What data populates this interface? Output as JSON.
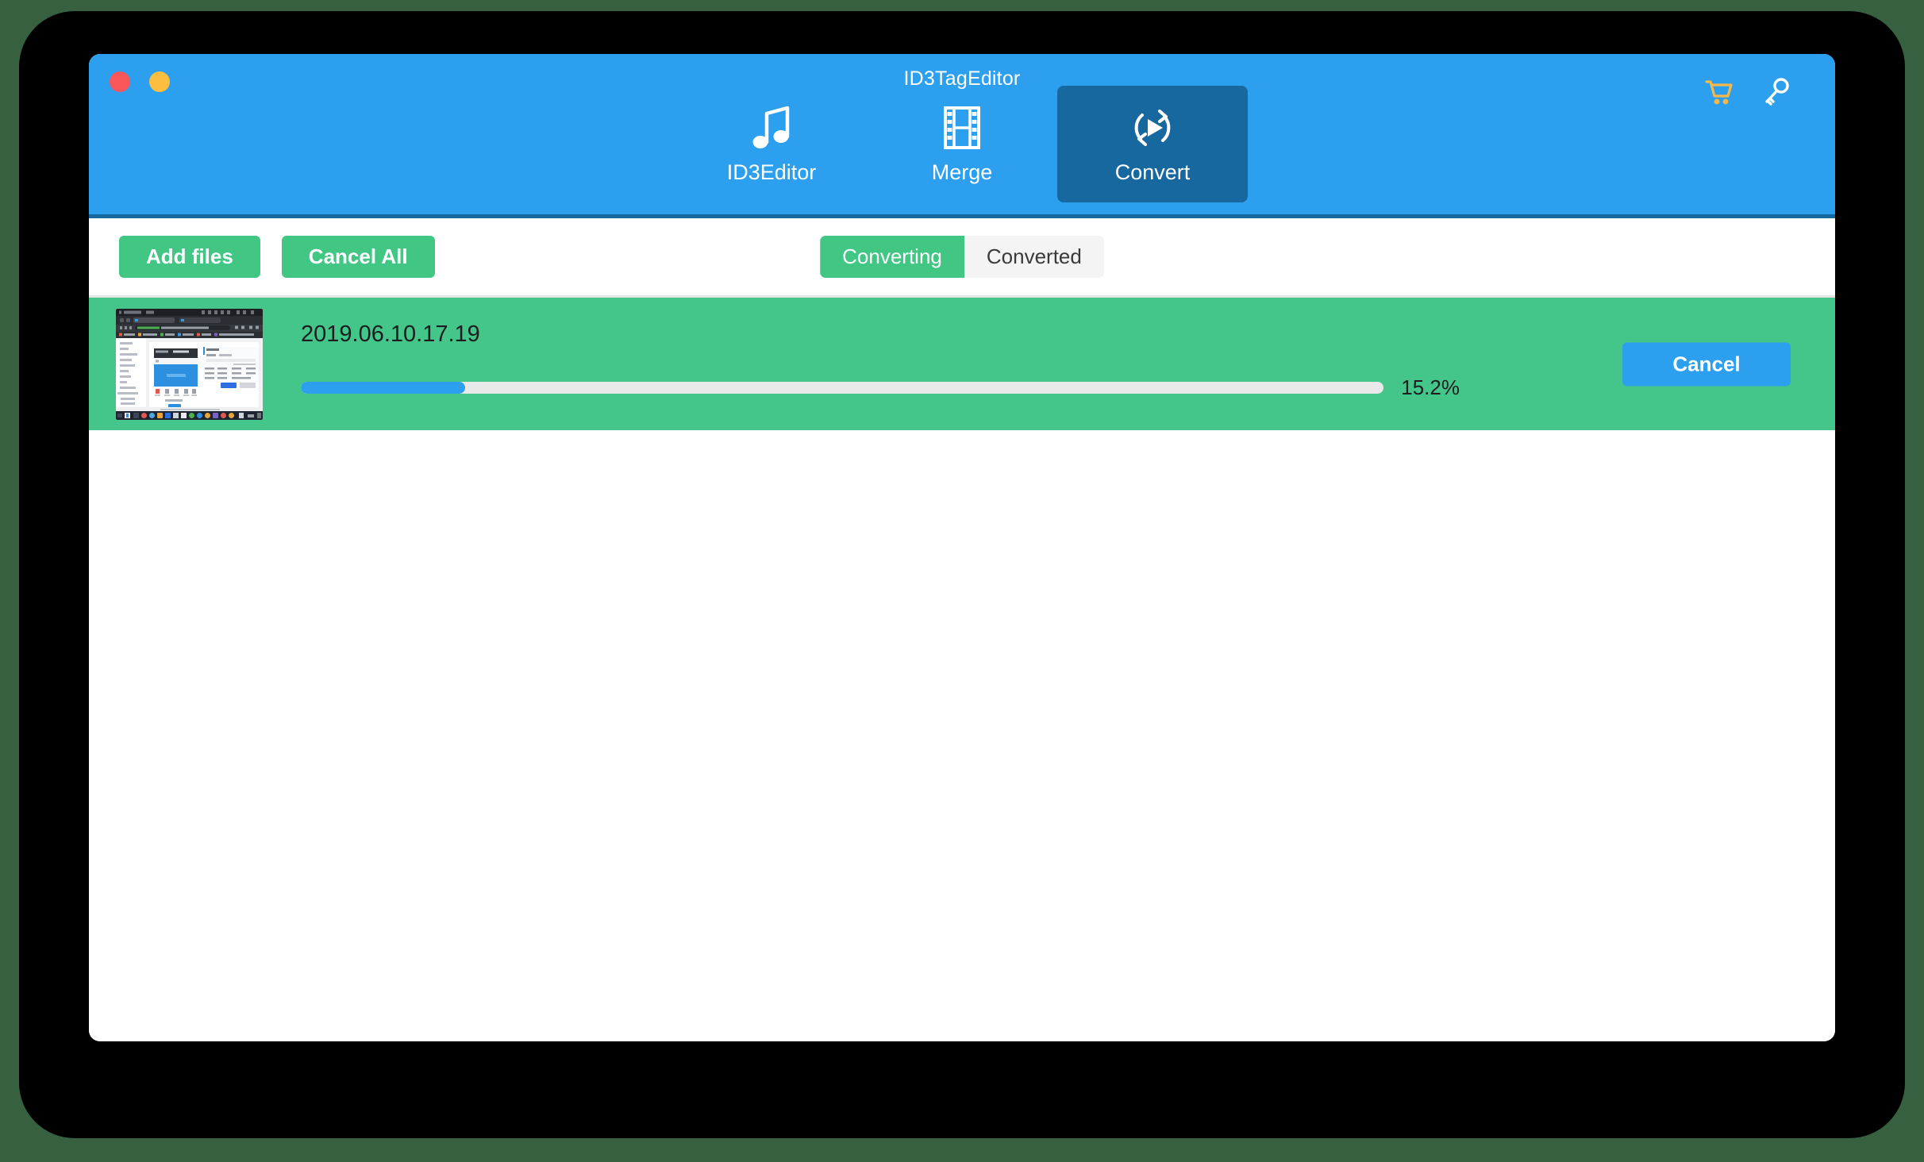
{
  "window": {
    "title": "ID3TagEditor",
    "traffic_lights": [
      {
        "name": "close",
        "color": "#f9565a"
      },
      {
        "name": "minimize",
        "color": "#fcbd40"
      }
    ]
  },
  "header": {
    "background": "#2c9fee",
    "active_tab_background": "#17689f",
    "tabs": [
      {
        "id": "id3editor",
        "label": "ID3Editor",
        "icon": "music-note-icon",
        "active": false
      },
      {
        "id": "merge",
        "label": "Merge",
        "icon": "film-strip-icon",
        "active": false
      },
      {
        "id": "convert",
        "label": "Convert",
        "icon": "convert-refresh-play-icon",
        "active": true
      }
    ],
    "actions": [
      {
        "id": "cart",
        "icon": "shopping-cart-icon",
        "color": "#f7b84a"
      },
      {
        "id": "register",
        "icon": "key-icon",
        "color": "#ffffff"
      }
    ]
  },
  "toolbar": {
    "add_files_label": "Add files",
    "cancel_all_label": "Cancel All",
    "button_color": "#41c684",
    "segments": [
      {
        "id": "converting",
        "label": "Converting",
        "active": true
      },
      {
        "id": "converted",
        "label": "Converted",
        "active": false
      }
    ]
  },
  "file_list": {
    "row_background": "#44c68b",
    "rows": [
      {
        "name": "2019.06.10.17.19",
        "progress_percent": 15.2,
        "progress_label": "15.2%",
        "progress_fill_color": "#2c9fee",
        "progress_track_color": "#e9e9e9",
        "action_label": "Cancel",
        "action_color": "#2c9fee",
        "thumbnail": "video-frame-screen-recording"
      }
    ]
  }
}
